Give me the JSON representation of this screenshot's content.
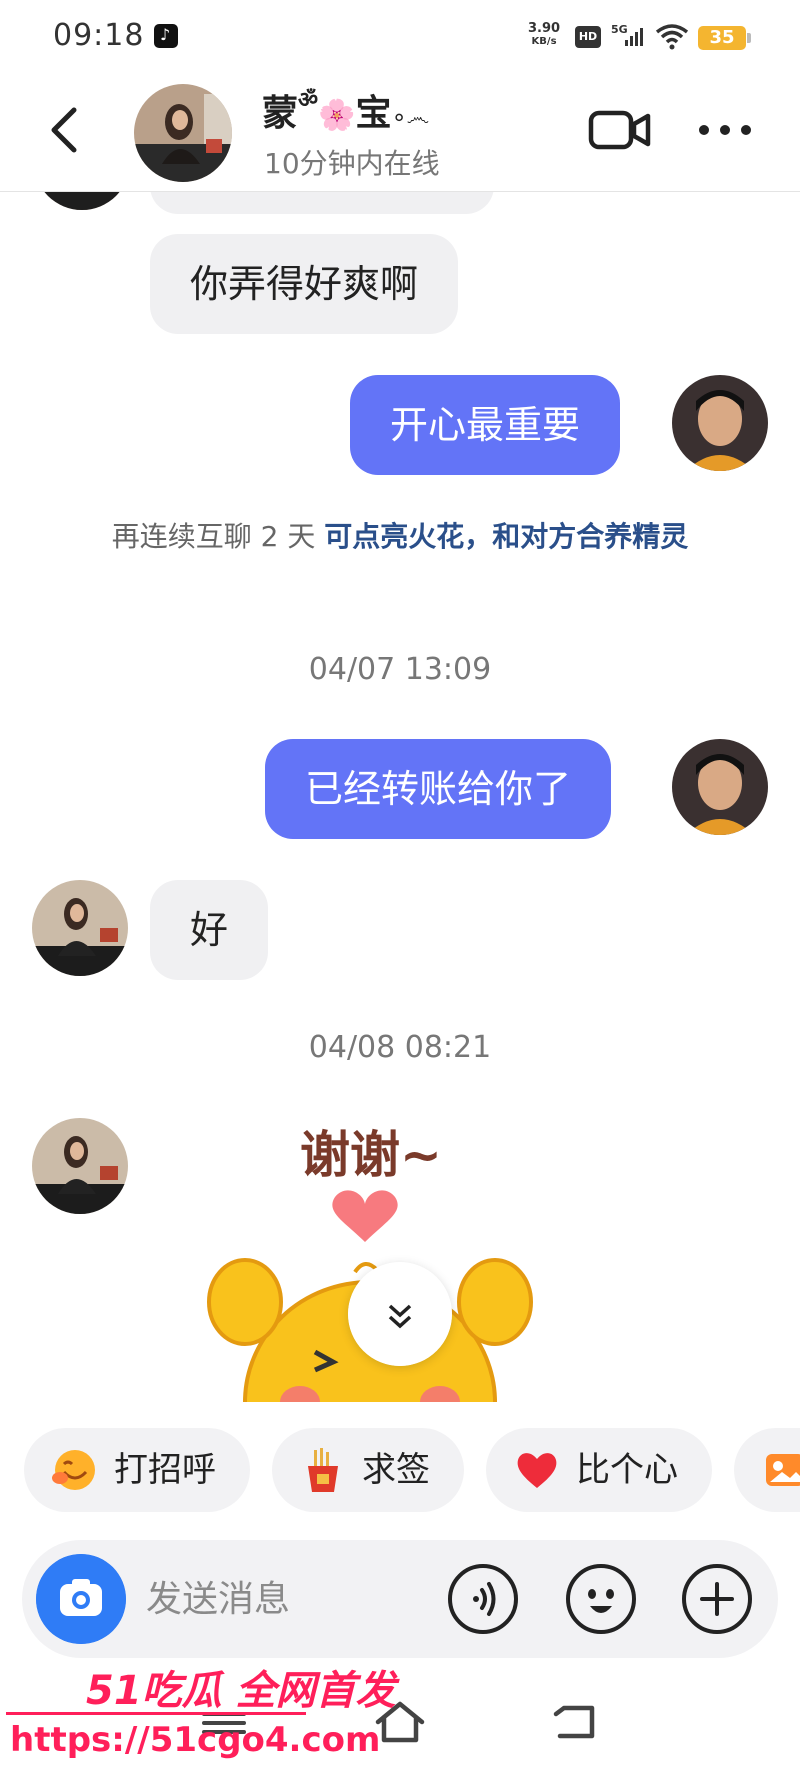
{
  "status_bar": {
    "time": "09:18",
    "net_speed_value": "3.90",
    "net_speed_unit": "KB/s",
    "hd": "HD",
    "network": "5G",
    "battery": "35"
  },
  "header": {
    "name": "蒙",
    "name_suffix": "宝",
    "online_status": "10分钟内在线"
  },
  "messages": {
    "partial_top": "",
    "msg1": "你弄得好爽啊",
    "msg2": "开心最重要",
    "spark_note_prefix": "再连续互聊 2 天 ",
    "spark_note_link": "可点亮火花，和对方合养精灵",
    "time1": "04/07 13:09",
    "msg3": "已经转账给你了",
    "msg4": "好",
    "time2": "04/08 08:21",
    "sticker_text": "谢谢~"
  },
  "quick_replies": [
    {
      "label": "打招呼",
      "icon": "smile-emoji-icon"
    },
    {
      "label": "求签",
      "icon": "fortune-stick-icon"
    },
    {
      "label": "比个心",
      "icon": "heart-icon"
    },
    {
      "label": "",
      "icon": "photo-album-icon"
    }
  ],
  "input": {
    "placeholder": "发送消息"
  },
  "watermark": {
    "title": "51吃瓜 全网首发",
    "url": "https://51cgo4.com"
  },
  "colors": {
    "outgoing_bubble": "#6374f7",
    "incoming_bubble": "#f0f0f2",
    "camera_button": "#2f7cf6",
    "watermark": "#ff1f5a"
  }
}
